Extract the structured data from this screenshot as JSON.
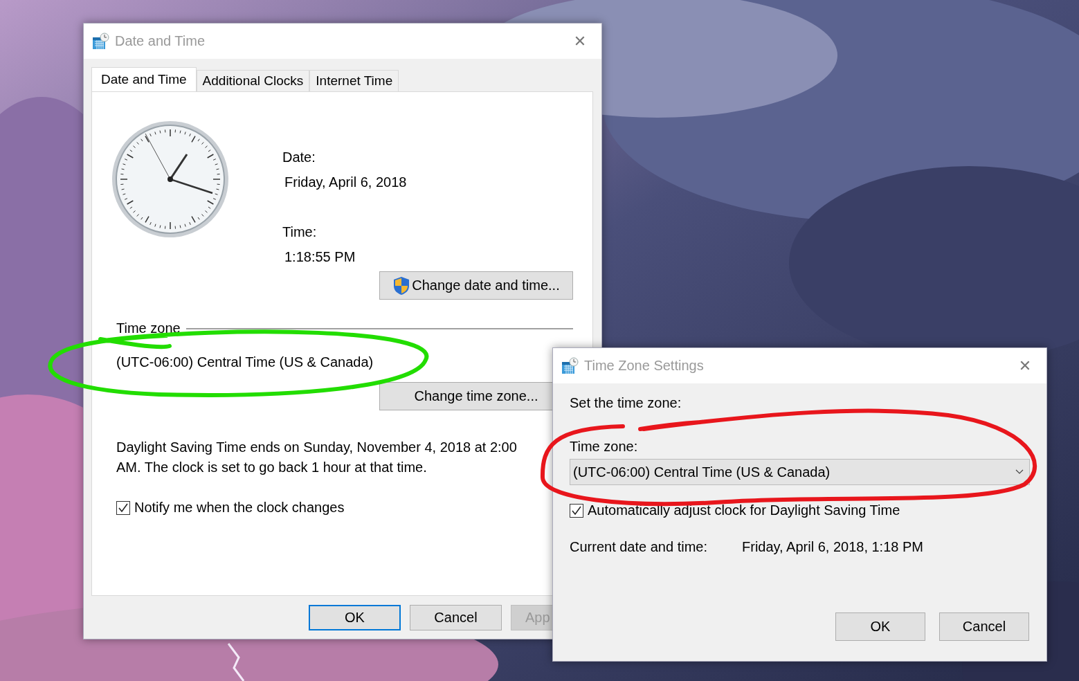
{
  "date_time_dialog": {
    "title": "Date and Time",
    "close": "✕",
    "tabs": [
      {
        "label": "Date and Time",
        "selected": true
      },
      {
        "label": "Additional Clocks",
        "selected": false
      },
      {
        "label": "Internet Time",
        "selected": false
      }
    ],
    "date_label": "Date:",
    "date": "Friday, April 6, 2018",
    "time_label": "Time:",
    "time": "1:18:55 PM",
    "change_date_button": "Change date and time...",
    "time_zone_group": "Time zone",
    "time_zone": "(UTC-06:00) Central Time (US & Canada)",
    "change_time_zone_button": "Change time zone...",
    "dst_note": "Daylight Saving Time ends on Sunday, November 4, 2018 at 2:00 AM. The clock is set to go back 1 hour at that time.",
    "notify_checkbox": {
      "label": "Notify me when the clock changes",
      "checked": true
    },
    "buttons": [
      {
        "label": "OK",
        "default": true,
        "disabled": false
      },
      {
        "label": "Cancel",
        "default": false,
        "disabled": false
      },
      {
        "label": "App",
        "default": false,
        "disabled": true
      }
    ]
  },
  "time_zone_dialog": {
    "title": "Time Zone Settings",
    "close": "✕",
    "heading": "Set the time zone:",
    "time_zone_label": "Time zone:",
    "time_zone_dropdown": "(UTC-06:00) Central Time (US & Canada)",
    "dst_checkbox": {
      "label": "Automatically adjust clock for Daylight Saving Time",
      "checked": true
    },
    "current_label": "Current date and time:",
    "current_value": "Friday, April 6, 2018, 1:18 PM",
    "buttons": [
      {
        "label": "OK",
        "default": false,
        "disabled": false
      },
      {
        "label": "Cancel",
        "default": false,
        "disabled": false
      }
    ]
  },
  "annotations": [
    {
      "kind": "green-loop",
      "color": "#22dd00"
    },
    {
      "kind": "red-loop",
      "color": "#e8161c"
    }
  ]
}
